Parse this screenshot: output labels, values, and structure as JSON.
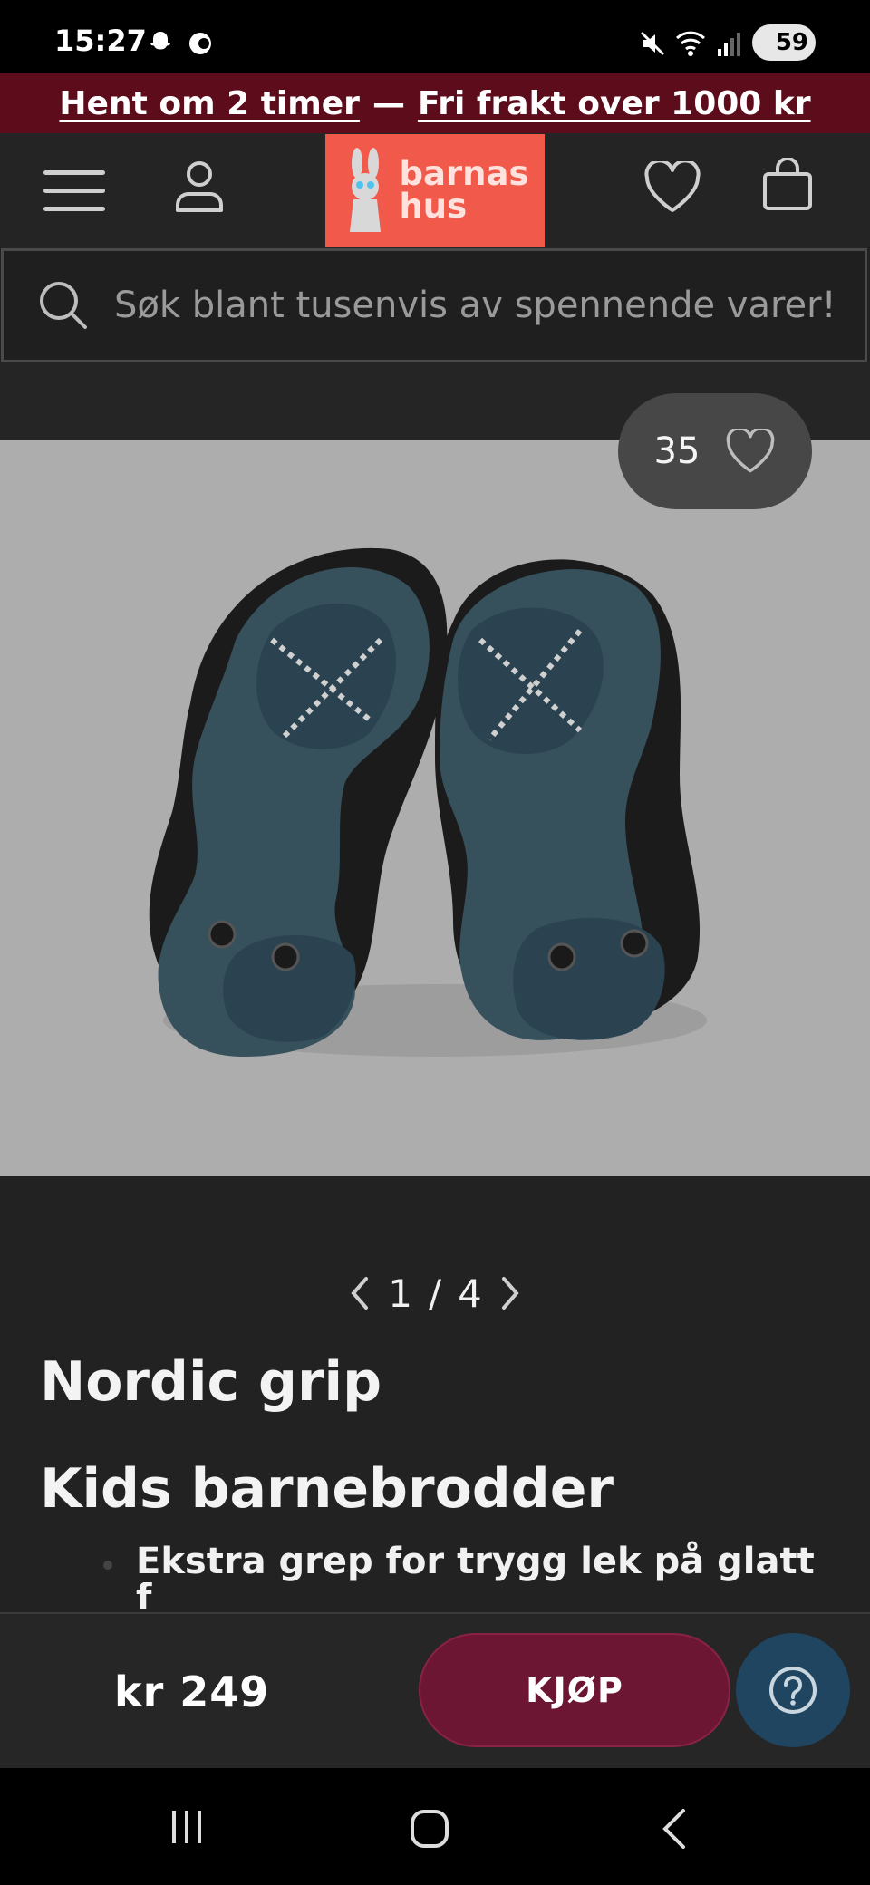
{
  "status_bar": {
    "time": "15:27",
    "battery": "59",
    "icons": [
      "snapchat-icon",
      "vpn-icon",
      "mute-icon",
      "wifi-icon",
      "signal-icon"
    ]
  },
  "promo": {
    "pickup": "Hent om 2 timer",
    "separator": "—",
    "shipping": "Fri frakt over 1000 kr"
  },
  "header": {
    "logo_line1": "barnas",
    "logo_line2": "hus",
    "icons": [
      "menu-icon",
      "account-icon",
      "heart-icon",
      "cart-icon"
    ]
  },
  "search": {
    "placeholder": "Søk blant tusenvis av spennende varer!"
  },
  "gallery": {
    "wishlist_count": "35",
    "current": "1",
    "separator": "/",
    "total": "4"
  },
  "product": {
    "brand": "Nordic grip",
    "name": "Kids barnebrodder",
    "feature_1": "Ekstra grep for trygg lek på glatt",
    "feature_1_cut": "f"
  },
  "purchase": {
    "price": "kr 249",
    "buy_label": "KJØP"
  },
  "colors": {
    "promo_bg": "#5c0c1a",
    "logo_bg": "#f15a4a",
    "buy_button": "#6c1634",
    "help_button": "#1f4560"
  }
}
